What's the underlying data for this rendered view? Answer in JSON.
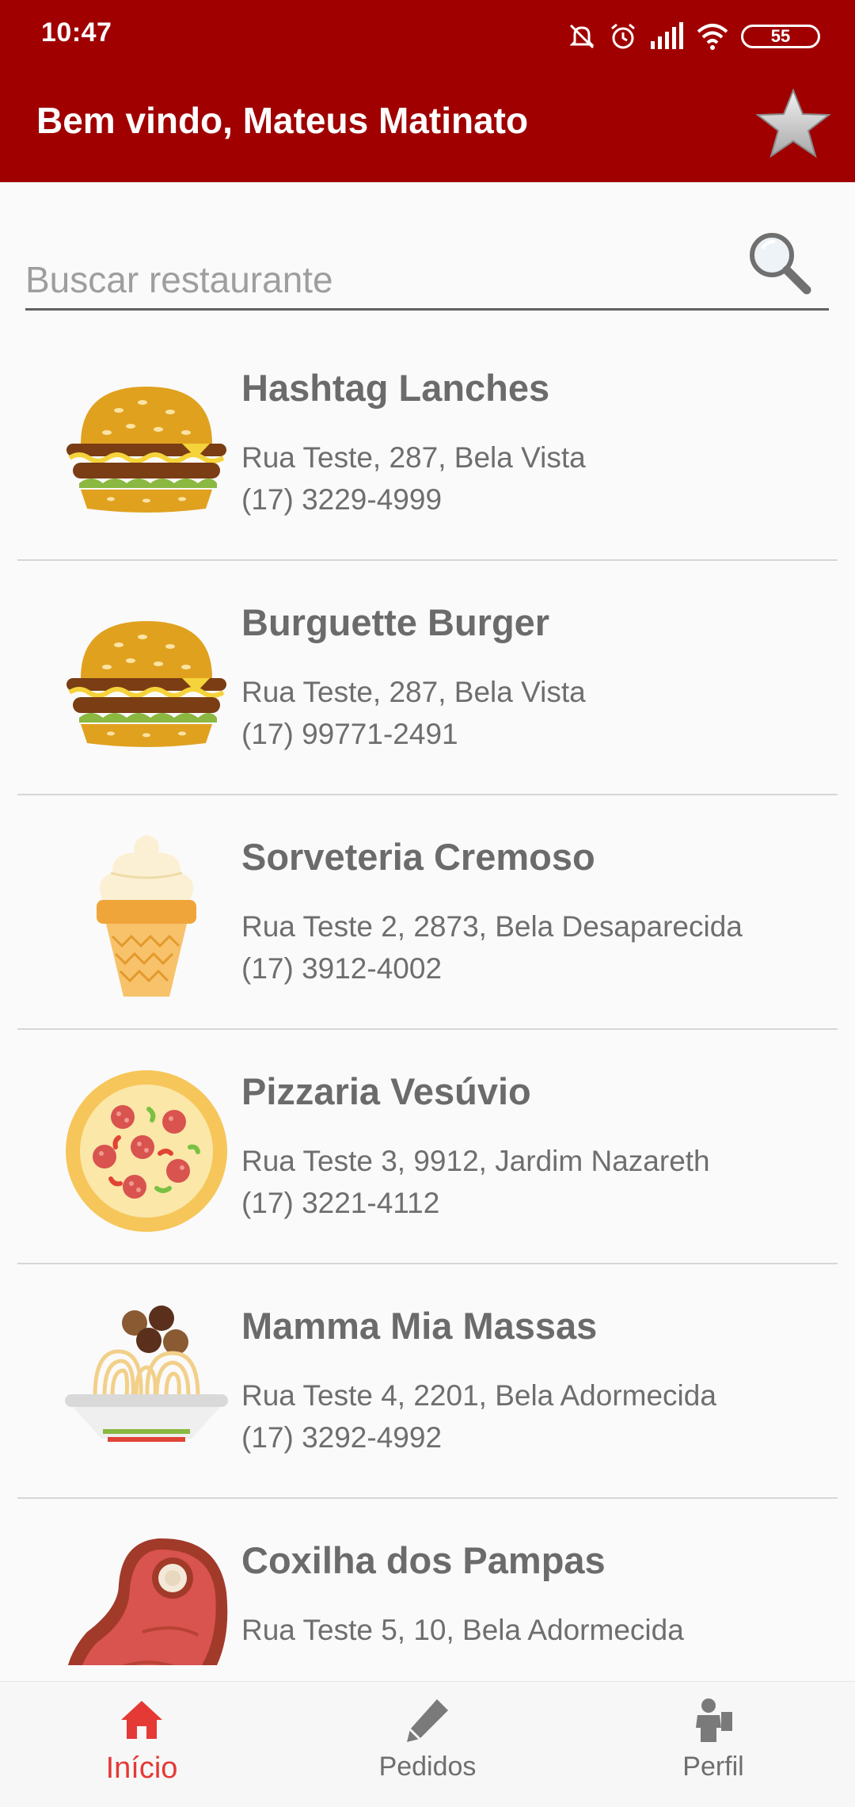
{
  "status_bar": {
    "time": "10:47",
    "battery": "55"
  },
  "header": {
    "title": "Bem vindo, Mateus Matinato",
    "favorite_icon": "star-icon"
  },
  "search": {
    "placeholder": "Buscar restaurante",
    "value": "",
    "icon": "search-icon"
  },
  "restaurants": [
    {
      "name": "Hashtag Lanches",
      "address": "Rua Teste, 287, Bela Vista",
      "phone": "(17) 3229-4999",
      "icon": "burger-icon"
    },
    {
      "name": "Burguette Burger",
      "address": "Rua Teste, 287, Bela Vista",
      "phone": "(17) 99771-2491",
      "icon": "burger-icon"
    },
    {
      "name": "Sorveteria Cremoso",
      "address": "Rua Teste 2, 2873, Bela Desaparecida",
      "phone": "(17) 3912-4002",
      "icon": "ice-cream-icon"
    },
    {
      "name": "Pizzaria Vesúvio",
      "address": "Rua Teste 3, 9912, Jardim Nazareth",
      "phone": "(17) 3221-4112",
      "icon": "pizza-icon"
    },
    {
      "name": "Mamma Mia Massas",
      "address": "Rua Teste 4, 2201, Bela Adormecida",
      "phone": "(17) 3292-4992",
      "icon": "pasta-icon"
    },
    {
      "name": "Coxilha dos Pampas",
      "address": "Rua Teste 5, 10, Bela Adormecida",
      "phone": "",
      "icon": "steak-icon"
    }
  ],
  "bottom_nav": [
    {
      "label": "Início",
      "icon": "home-icon",
      "active": true
    },
    {
      "label": "Pedidos",
      "icon": "pencil-icon",
      "active": false
    },
    {
      "label": "Perfil",
      "icon": "person-icon",
      "active": false
    }
  ],
  "colors": {
    "app_bar": "#a00000",
    "accent": "#e53935",
    "text_gray": "#6e6e6e"
  }
}
